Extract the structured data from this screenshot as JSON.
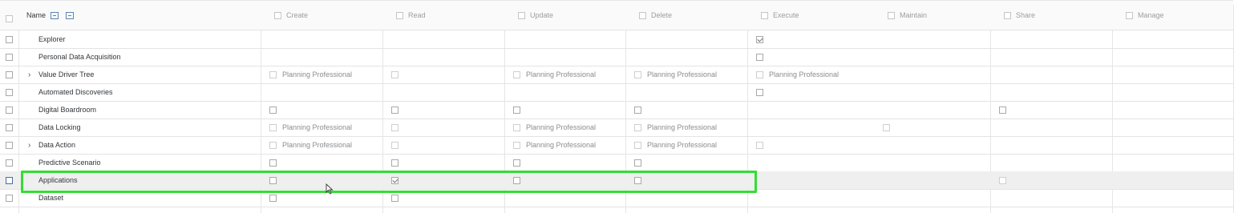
{
  "header": {
    "name_label": "Name",
    "columns": [
      "Create",
      "Read",
      "Update",
      "Delete",
      "Execute",
      "Maintain",
      "Share",
      "Manage"
    ]
  },
  "rows": [
    {
      "name": "Explorer",
      "expandable": false,
      "cells": {
        "execute": {
          "checked": true
        }
      }
    },
    {
      "name": "Personal Data Acquisition",
      "expandable": false,
      "cells": {
        "execute": {}
      }
    },
    {
      "name": "Value Driver Tree",
      "expandable": true,
      "cells": {
        "create": {
          "disabled": true,
          "label": "Planning Professional"
        },
        "read": {
          "disabled": true
        },
        "update": {
          "disabled": true,
          "label": "Planning Professional"
        },
        "delete": {
          "disabled": true,
          "label": "Planning Professional"
        },
        "execute": {
          "disabled": true,
          "label": "Planning Professional"
        }
      }
    },
    {
      "name": "Automated Discoveries",
      "expandable": false,
      "cells": {
        "execute": {}
      }
    },
    {
      "name": "Digital Boardroom",
      "expandable": false,
      "cells": {
        "create": {},
        "read": {},
        "update": {},
        "delete": {},
        "share": {}
      }
    },
    {
      "name": "Data Locking",
      "expandable": false,
      "cells": {
        "create": {
          "disabled": true,
          "label": "Planning Professional"
        },
        "read": {
          "disabled": true
        },
        "update": {
          "disabled": true,
          "label": "Planning Professional"
        },
        "delete": {
          "disabled": true,
          "label": "Planning Professional"
        },
        "maintain": {
          "disabled": true
        }
      }
    },
    {
      "name": "Data Action",
      "expandable": true,
      "cells": {
        "create": {
          "disabled": true,
          "label": "Planning Professional"
        },
        "read": {
          "disabled": true
        },
        "update": {
          "disabled": true,
          "label": "Planning Professional"
        },
        "delete": {
          "disabled": true,
          "label": "Planning Professional"
        },
        "execute": {
          "disabled": true
        }
      }
    },
    {
      "name": "Predictive Scenario",
      "expandable": false,
      "cells": {
        "create": {},
        "read": {},
        "update": {},
        "delete": {}
      }
    },
    {
      "name": "Applications",
      "expandable": false,
      "selected": true,
      "cells": {
        "create": {},
        "read": {
          "checked": true
        },
        "update": {},
        "delete": {},
        "share": {
          "disabled": true
        }
      }
    },
    {
      "name": "Dataset",
      "expandable": false,
      "cells": {
        "create": {},
        "read": {}
      }
    }
  ],
  "colors": {
    "highlight": "#33dd33",
    "selected_row_bg": "#efefef",
    "header_bg": "#fafafa"
  }
}
